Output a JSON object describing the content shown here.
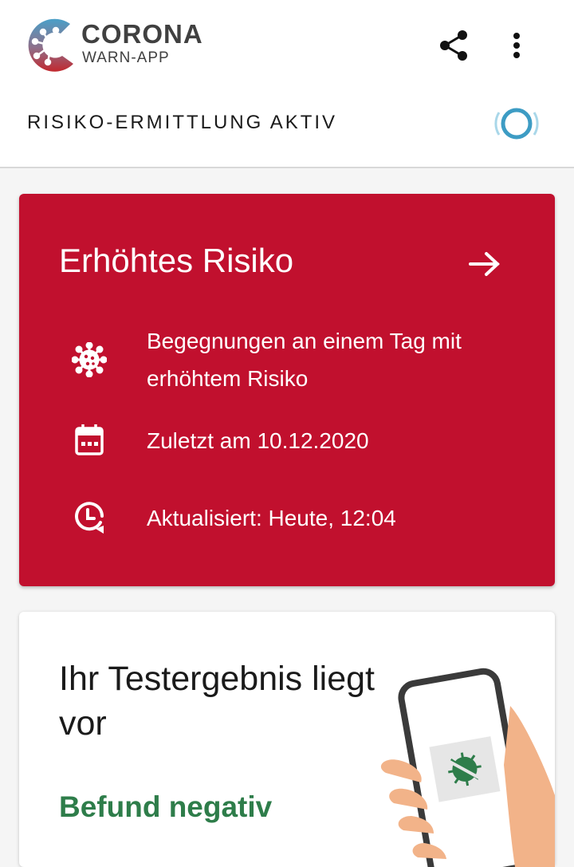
{
  "header": {
    "logo_line1": "CORONA",
    "logo_line2": "WARN-APP",
    "share_icon": "share-icon",
    "more_icon": "more-vertical-icon"
  },
  "status": {
    "label": "RISIKO-ERMITTLUNG AKTIV"
  },
  "risk_card": {
    "title": "Erhöhtes Risiko",
    "encounters": "Begegnungen an einem Tag mit erhöhtem Risiko",
    "last_date": "Zuletzt am 10.12.2020",
    "updated": "Aktualisiert: Heute, 12:04",
    "color": "#c1102e"
  },
  "test_card": {
    "title": "Ihr Testergebnis liegt vor",
    "result": "Befund negativ",
    "result_color": "#2e7d4a"
  }
}
